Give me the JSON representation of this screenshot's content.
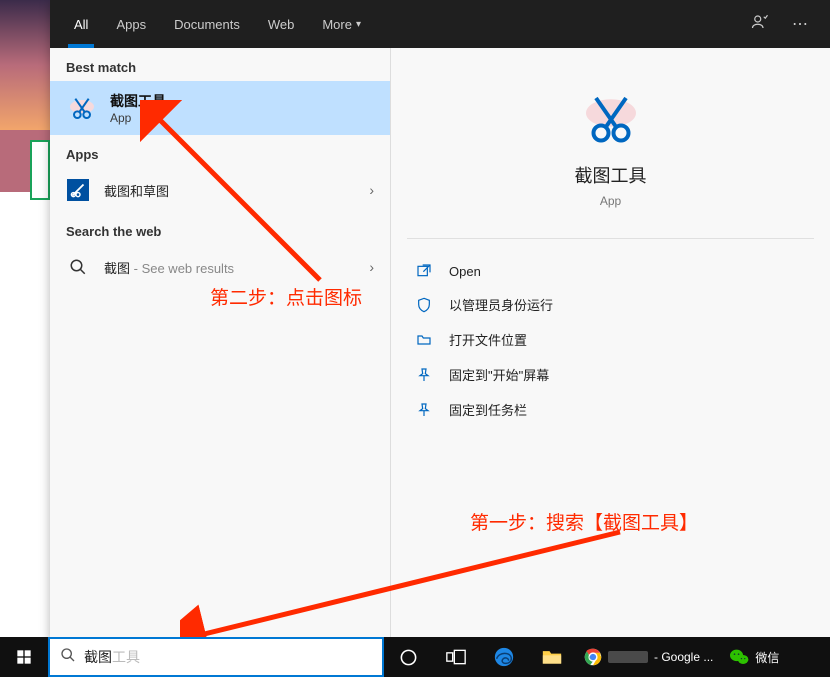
{
  "tabs": {
    "all": "All",
    "apps": "Apps",
    "documents": "Documents",
    "web": "Web",
    "more": "More"
  },
  "left": {
    "best_match_label": "Best match",
    "best": {
      "title": "截图工具",
      "sub": "App"
    },
    "apps_label": "Apps",
    "app_row": {
      "title": "截图和草图"
    },
    "web_label": "Search the web",
    "web_row": {
      "prefix": "截图",
      "suffix": " - See web results"
    }
  },
  "preview": {
    "name": "截图工具",
    "type": "App"
  },
  "actions": {
    "open": "Open",
    "admin": "以管理员身份运行",
    "loc": "打开文件位置",
    "pin_start": "固定到\"开始\"屏幕",
    "pin_task": "固定到任务栏"
  },
  "annotations": {
    "step1": "第一步：搜索【截图工具】",
    "step2": "第二步：点击图标"
  },
  "taskbar": {
    "search_value": "截图",
    "search_ghost": "工具",
    "chrome_label": "- Google ...",
    "wechat": "微信"
  },
  "colors": {
    "accent": "#0078d4",
    "anno": "#ff2a00"
  }
}
